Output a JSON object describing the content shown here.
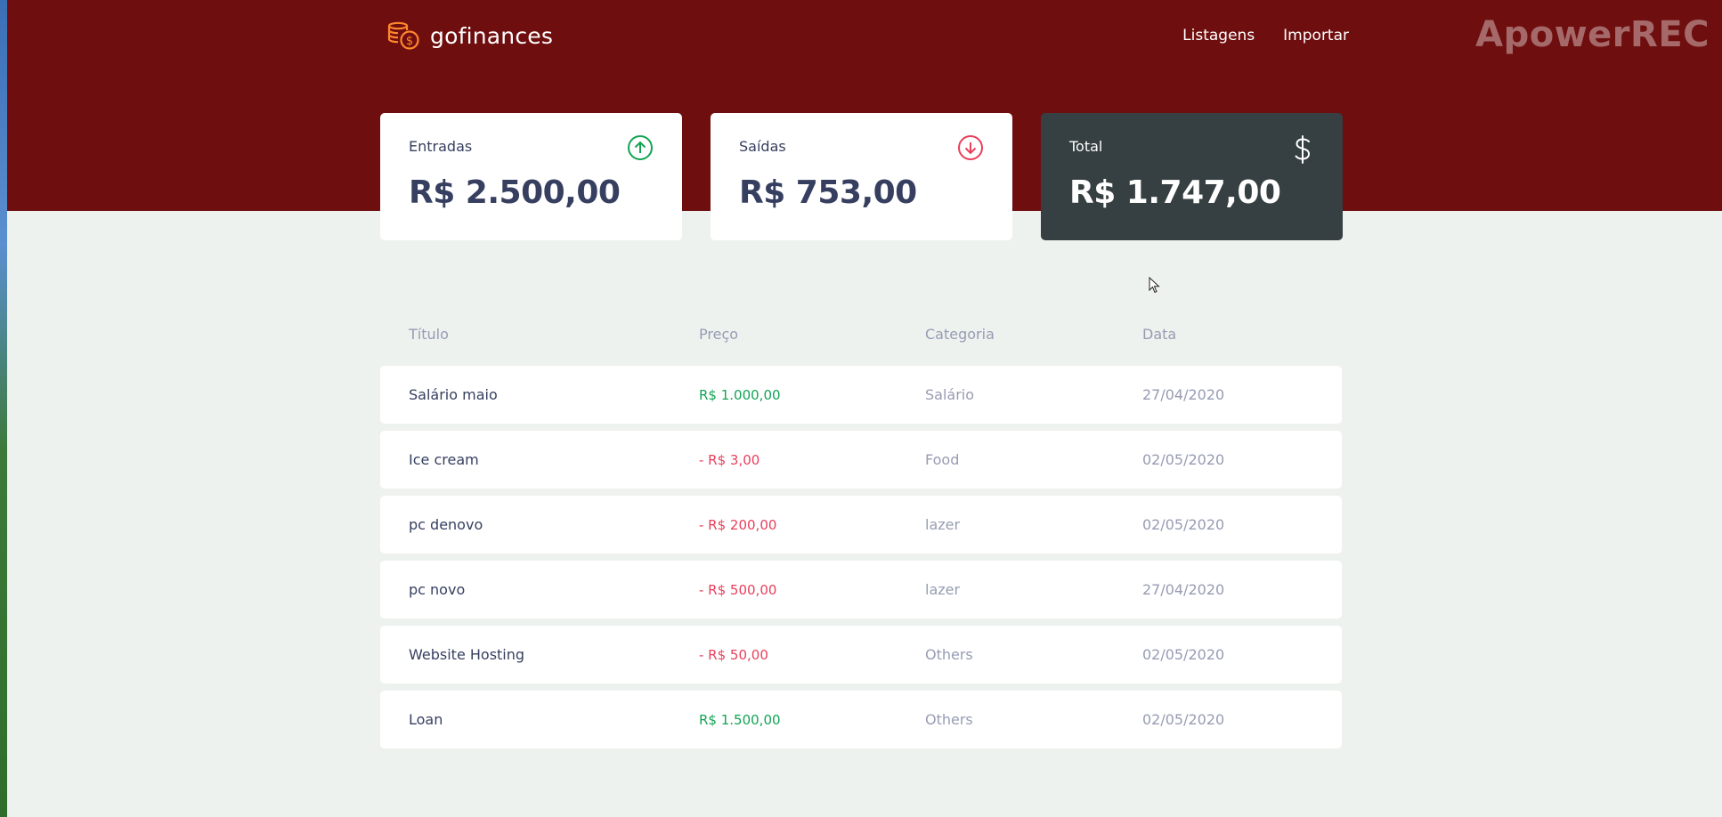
{
  "app": {
    "name": "gofinances",
    "watermark": "ApowerREC"
  },
  "nav": {
    "items": [
      "Listagens",
      "Importar"
    ]
  },
  "cards": [
    {
      "label": "Entradas",
      "value": "R$ 2.500,00",
      "icon": "arrow-up-circle-icon"
    },
    {
      "label": "Saídas",
      "value": "R$ 753,00",
      "icon": "arrow-down-circle-icon"
    },
    {
      "label": "Total",
      "value": "R$ 1.747,00",
      "icon": "dollar-sign-icon"
    }
  ],
  "table": {
    "headers": [
      "Título",
      "Preço",
      "Categoria",
      "Data"
    ],
    "rows": [
      {
        "title": "Salário maio",
        "price": "R$ 1.000,00",
        "type": "income",
        "category": "Salário",
        "date": "27/04/2020"
      },
      {
        "title": "Ice cream",
        "price": "- R$ 3,00",
        "type": "outcome",
        "category": "Food",
        "date": "02/05/2020"
      },
      {
        "title": "pc denovo",
        "price": "- R$ 200,00",
        "type": "outcome",
        "category": "lazer",
        "date": "02/05/2020"
      },
      {
        "title": "pc novo",
        "price": "- R$ 500,00",
        "type": "outcome",
        "category": "lazer",
        "date": "27/04/2020"
      },
      {
        "title": "Website Hosting",
        "price": "- R$ 50,00",
        "type": "outcome",
        "category": "Others",
        "date": "02/05/2020"
      },
      {
        "title": "Loan",
        "price": "R$ 1.500,00",
        "type": "income",
        "category": "Others",
        "date": "02/05/2020"
      }
    ]
  },
  "colors": {
    "header": "#6f0e0f",
    "income": "#12a454",
    "outcome": "#e83f5b",
    "logo": "#ff872c",
    "total_card": "#363f41"
  }
}
